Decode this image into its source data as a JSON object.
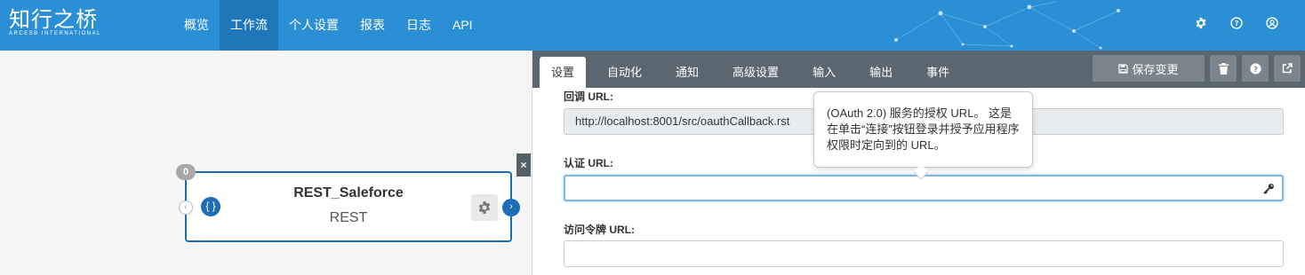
{
  "logo": {
    "cn": "知行之桥",
    "en": "ARCESB INTERNATIONAL"
  },
  "nav": {
    "items": [
      {
        "label": "概览"
      },
      {
        "label": "工作流"
      },
      {
        "label": "个人设置"
      },
      {
        "label": "报表"
      },
      {
        "label": "日志"
      },
      {
        "label": "API"
      }
    ],
    "active": "工作流"
  },
  "top_icons": [
    "gear-icon",
    "help-icon",
    "user-icon"
  ],
  "node": {
    "badge": "0",
    "title": "REST_Saleforce",
    "subtitle": "REST",
    "type_icon": "{ }"
  },
  "close_label": "×",
  "panel": {
    "tabs": [
      {
        "label": "设置"
      },
      {
        "label": "自动化"
      },
      {
        "label": "通知"
      },
      {
        "label": "高级设置"
      },
      {
        "label": "输入"
      },
      {
        "label": "输出"
      },
      {
        "label": "事件"
      }
    ],
    "save_label": "保存变更"
  },
  "form": {
    "callback_label": "回调 URL:",
    "callback_value": "http://localhost:8001/src/oauthCallback.rst",
    "auth_label": "认证 URL:",
    "auth_value": "",
    "token_label": "访问令牌 URL:",
    "token_value": ""
  },
  "tooltip": {
    "line1": "(OAuth 2.0) 服务的授权 URL。 这是",
    "line2": "在单击“连接”按钮登录并授予应用程序",
    "line3": "权限时定向到的 URL。"
  },
  "colors": {
    "topbar": "#2b8fd6",
    "nav_active": "#1f76b8",
    "panel_header": "#5b6770",
    "node_border": "#1f6db5"
  }
}
